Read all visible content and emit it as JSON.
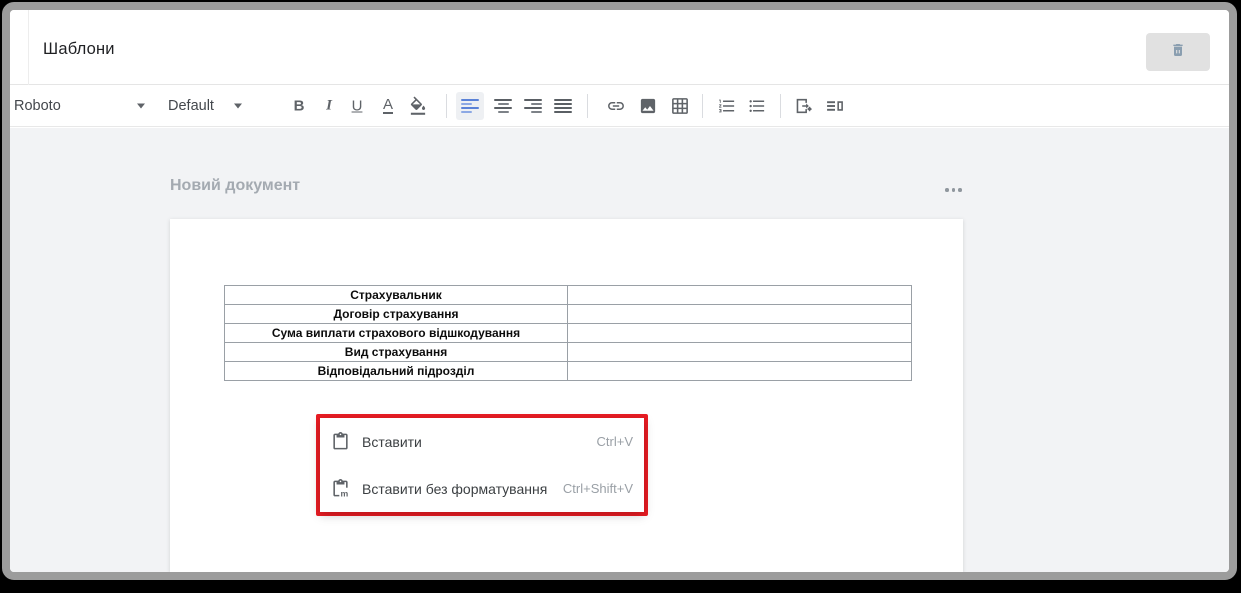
{
  "titlebar": {
    "title": "Шаблони",
    "trash_icon": "trash-icon"
  },
  "toolbar": {
    "font_family_value": "Roboto",
    "paragraph_style_value": "Default",
    "bold_label": "B",
    "italic_label": "I",
    "underline_label": "U",
    "text_color_label": "A",
    "icons": [
      "fill-color-icon",
      "align-left-icon",
      "align-center-icon",
      "align-right-icon",
      "align-justify-icon",
      "insert-link-icon",
      "insert-image-icon",
      "insert-table-icon",
      "numbered-list-icon",
      "bulleted-list-icon",
      "export-page-icon",
      "text-wrap-icon"
    ],
    "active_alignment": "left"
  },
  "content": {
    "document_title": "Новий документ",
    "more_options_icon": "three-dots-icon",
    "table": {
      "rows": [
        "Страхувальник",
        "Договір страхування",
        "Сума виплати страхового відшкодування",
        "Вид страхування",
        "Відповідальний підрозділ"
      ]
    },
    "context_menu": {
      "items": [
        {
          "icon": "paste-icon",
          "label": "Вставити",
          "shortcut": "Ctrl+V"
        },
        {
          "icon": "paste-without-formatting-icon",
          "label": "Вставити без форматування",
          "shortcut": "Ctrl+Shift+V"
        }
      ]
    }
  },
  "colors": {
    "annotation_red": "#e91c23",
    "accent_blue": "#5b82d7",
    "toolbar_icon_gray": "#5f6368",
    "content_background": "#f2f3f5",
    "table_border": "#9aa0a6",
    "frame_gray": "#9c9c9c"
  }
}
